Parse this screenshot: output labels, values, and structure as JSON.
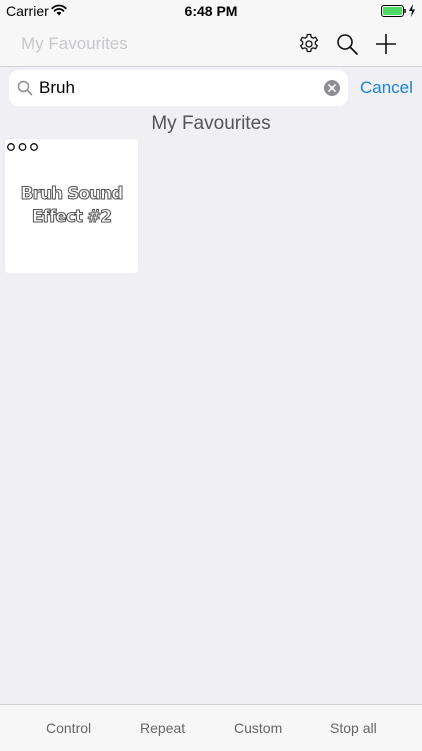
{
  "status_bar": {
    "carrier": "Carrier",
    "time": "6:48 PM",
    "battery_color": "#4cd964"
  },
  "nav": {
    "title": "My Favourites",
    "icons": [
      "gear-icon",
      "search-icon",
      "plus-icon"
    ]
  },
  "search": {
    "value": "Bruh",
    "placeholder": "",
    "cancel_label": "Cancel"
  },
  "section": {
    "title": "My Favourites"
  },
  "tiles": [
    {
      "label": "Bruh Sound Effect #2"
    }
  ],
  "tab_bar": {
    "items": [
      "Control",
      "Repeat",
      "Custom",
      "Stop all"
    ]
  },
  "colors": {
    "accent": "#1a82d8",
    "background": "#efeff4"
  }
}
